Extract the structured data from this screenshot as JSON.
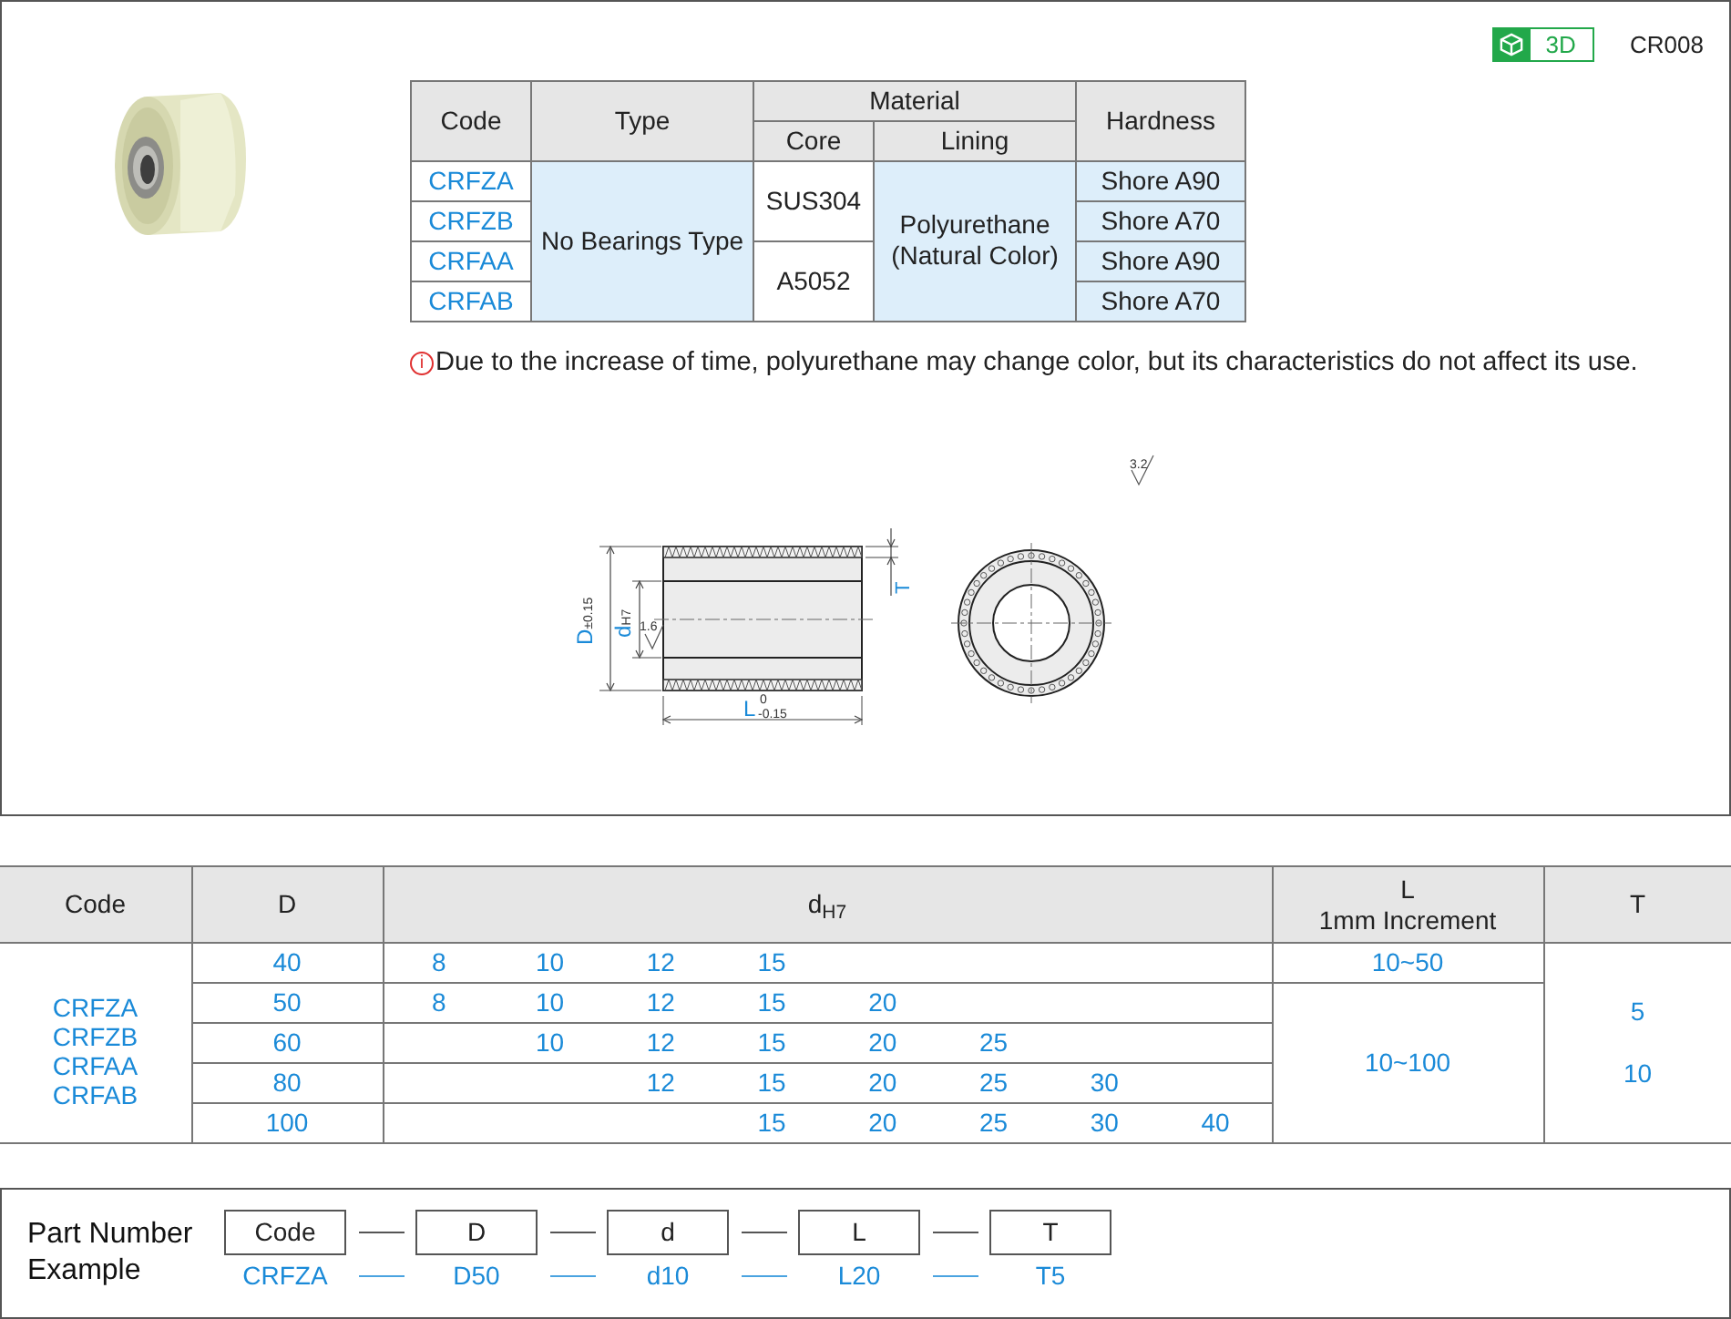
{
  "header": {
    "badge": "3D",
    "code": "CR008"
  },
  "spec_table": {
    "columns": [
      "Code",
      "Type",
      "Material",
      "Hardness"
    ],
    "material_columns": [
      "Core",
      "Lining"
    ],
    "codes": [
      "CRFZA",
      "CRFZB",
      "CRFAA",
      "CRFAB"
    ],
    "type": "No Bearings Type",
    "cores": [
      "SUS304",
      "A5052"
    ],
    "lining": [
      "Polyurethane",
      "(Natural Color)"
    ],
    "hardness": [
      "Shore A90",
      "Shore A70",
      "Shore A90",
      "Shore A70"
    ]
  },
  "note": {
    "icon": "i",
    "text": "Due to the increase of time, polyurethane may change color, but its characteristics do not affect its use."
  },
  "drawing": {
    "roughness_main": "3.2",
    "roughness_bore": "1.6",
    "d_outer": "D",
    "d_outer_tol": "±0.15",
    "d_inner": "d",
    "d_inner_tol": "H7",
    "thickness": "T",
    "length": "L",
    "length_tol_upper": "0",
    "length_tol_lower": "-0.15"
  },
  "dims_table": {
    "columns": [
      "Code",
      "D",
      "d$_{H7}$",
      "L",
      "T"
    ],
    "l_note": "1mm Increment",
    "codes": [
      "CRFZA",
      "CRFZB",
      "CRFAA",
      "CRFAB"
    ],
    "rows": [
      {
        "d": "40",
        "dh7": [
          {
            "kind": "value",
            "text": "8"
          },
          {
            "kind": "value",
            "text": "10"
          },
          {
            "kind": "value",
            "text": "12"
          },
          {
            "kind": "value",
            "text": "15"
          },
          {
            "kind": "blank"
          },
          {
            "kind": "blank"
          },
          {
            "kind": "blank"
          },
          {
            "kind": "blank"
          }
        ]
      },
      {
        "d": "50",
        "dh7": [
          {
            "kind": "value",
            "text": "8"
          },
          {
            "kind": "value",
            "text": "10"
          },
          {
            "kind": "value",
            "text": "12"
          },
          {
            "kind": "value",
            "text": "15"
          },
          {
            "kind": "value",
            "text": "20"
          },
          {
            "kind": "blank"
          },
          {
            "kind": "blank"
          },
          {
            "kind": "blank"
          }
        ]
      },
      {
        "d": "60",
        "dh7": [
          {
            "kind": "blank"
          },
          {
            "kind": "value",
            "text": "10"
          },
          {
            "kind": "value",
            "text": "12"
          },
          {
            "kind": "value",
            "text": "15"
          },
          {
            "kind": "value",
            "text": "20"
          },
          {
            "kind": "value",
            "text": "25"
          },
          {
            "kind": "blank"
          },
          {
            "kind": "blank"
          }
        ]
      },
      {
        "d": "80",
        "dh7": [
          {
            "kind": "blank"
          },
          {
            "kind": "blank"
          },
          {
            "kind": "value",
            "text": "12"
          },
          {
            "kind": "value",
            "text": "15"
          },
          {
            "kind": "value",
            "text": "20"
          },
          {
            "kind": "value",
            "text": "25"
          },
          {
            "kind": "value",
            "text": "30"
          },
          {
            "kind": "blank"
          }
        ]
      },
      {
        "d": "100",
        "dh7": [
          {
            "kind": "blank"
          },
          {
            "kind": "blank"
          },
          {
            "kind": "blank"
          },
          {
            "kind": "value",
            "text": "15"
          },
          {
            "kind": "value",
            "text": "20"
          },
          {
            "kind": "value",
            "text": "25"
          },
          {
            "kind": "value",
            "text": "30"
          },
          {
            "kind": "value",
            "text": "40"
          }
        ]
      }
    ],
    "l_values": [
      "10~50",
      "10~100"
    ],
    "t_values": [
      "5",
      "10"
    ]
  },
  "part_number": {
    "label": [
      "Part Number",
      "Example"
    ],
    "fields": [
      {
        "label": "Code",
        "example": "CRFZA"
      },
      {
        "label": "D",
        "example": "D50"
      },
      {
        "label": "d",
        "example": "d10"
      },
      {
        "label": "L",
        "example": "L20"
      },
      {
        "label": "T",
        "example": "T5"
      }
    ]
  }
}
